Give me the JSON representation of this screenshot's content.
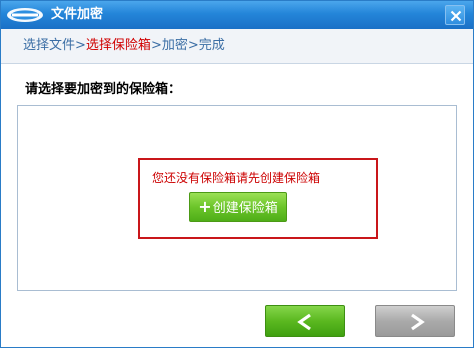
{
  "window": {
    "title": "文件加密",
    "logo_icon": "app-logo-icon",
    "close_icon": "close-icon"
  },
  "steps": {
    "items": [
      "选择文件",
      "选择保险箱",
      "加密",
      "完成"
    ],
    "separator": ">",
    "active_index": 1
  },
  "main": {
    "prompt": "请选择要加密到的保险箱："
  },
  "empty_state": {
    "message": "您还没有保险箱请先创建保险箱",
    "create_button_icon": "+",
    "create_button_label": "创建保险箱"
  },
  "footer": {
    "back_icon": "arrow-left-icon",
    "next_icon": "arrow-right-icon"
  },
  "colors": {
    "title_bar": "#2485d9",
    "active_step": "#d00000",
    "step": "#3b6ea5",
    "warning_border": "#c9161a",
    "create_button": "#6cc52a",
    "back_button": "#5bb820",
    "next_button_disabled": "#aaaaaa"
  }
}
